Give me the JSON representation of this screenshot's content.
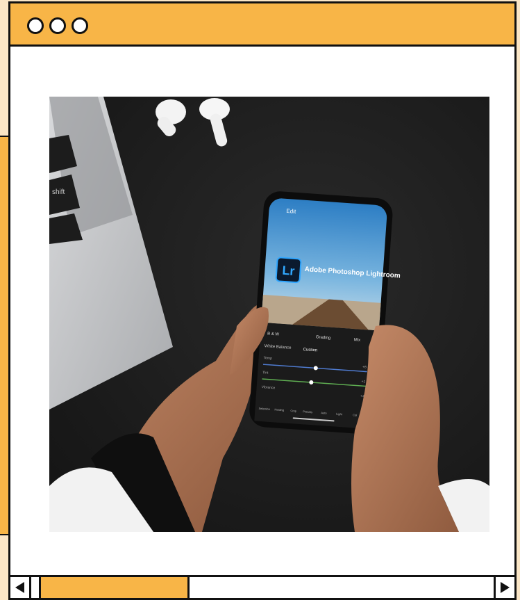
{
  "window": {
    "controls": [
      "window-dot",
      "window-dot",
      "window-dot"
    ]
  },
  "photo": {
    "app_name": "Adobe Photoshop Lightroom",
    "app_logo_text": "Lr",
    "screen": {
      "edit_label": "Edit",
      "tabs": [
        "B & W",
        "Grading",
        "Mix"
      ],
      "white_balance_label": "White Balance",
      "white_balance_value": "Custom",
      "sliders": [
        {
          "label": "Temp",
          "value": "+8"
        },
        {
          "label": "Tint",
          "value": "+1"
        },
        {
          "label": "Vibrance",
          "value": "+4"
        }
      ],
      "toolbar": [
        "Selection",
        "Healing",
        "Crop",
        "Presets",
        "Auto",
        "Light",
        "Col"
      ]
    },
    "keyboard_key": "shift"
  },
  "scrollbar": {
    "position": 0.0
  },
  "colors": {
    "accent": "#f8b547",
    "border": "#111111",
    "page_bg": "#fbe6c6"
  }
}
